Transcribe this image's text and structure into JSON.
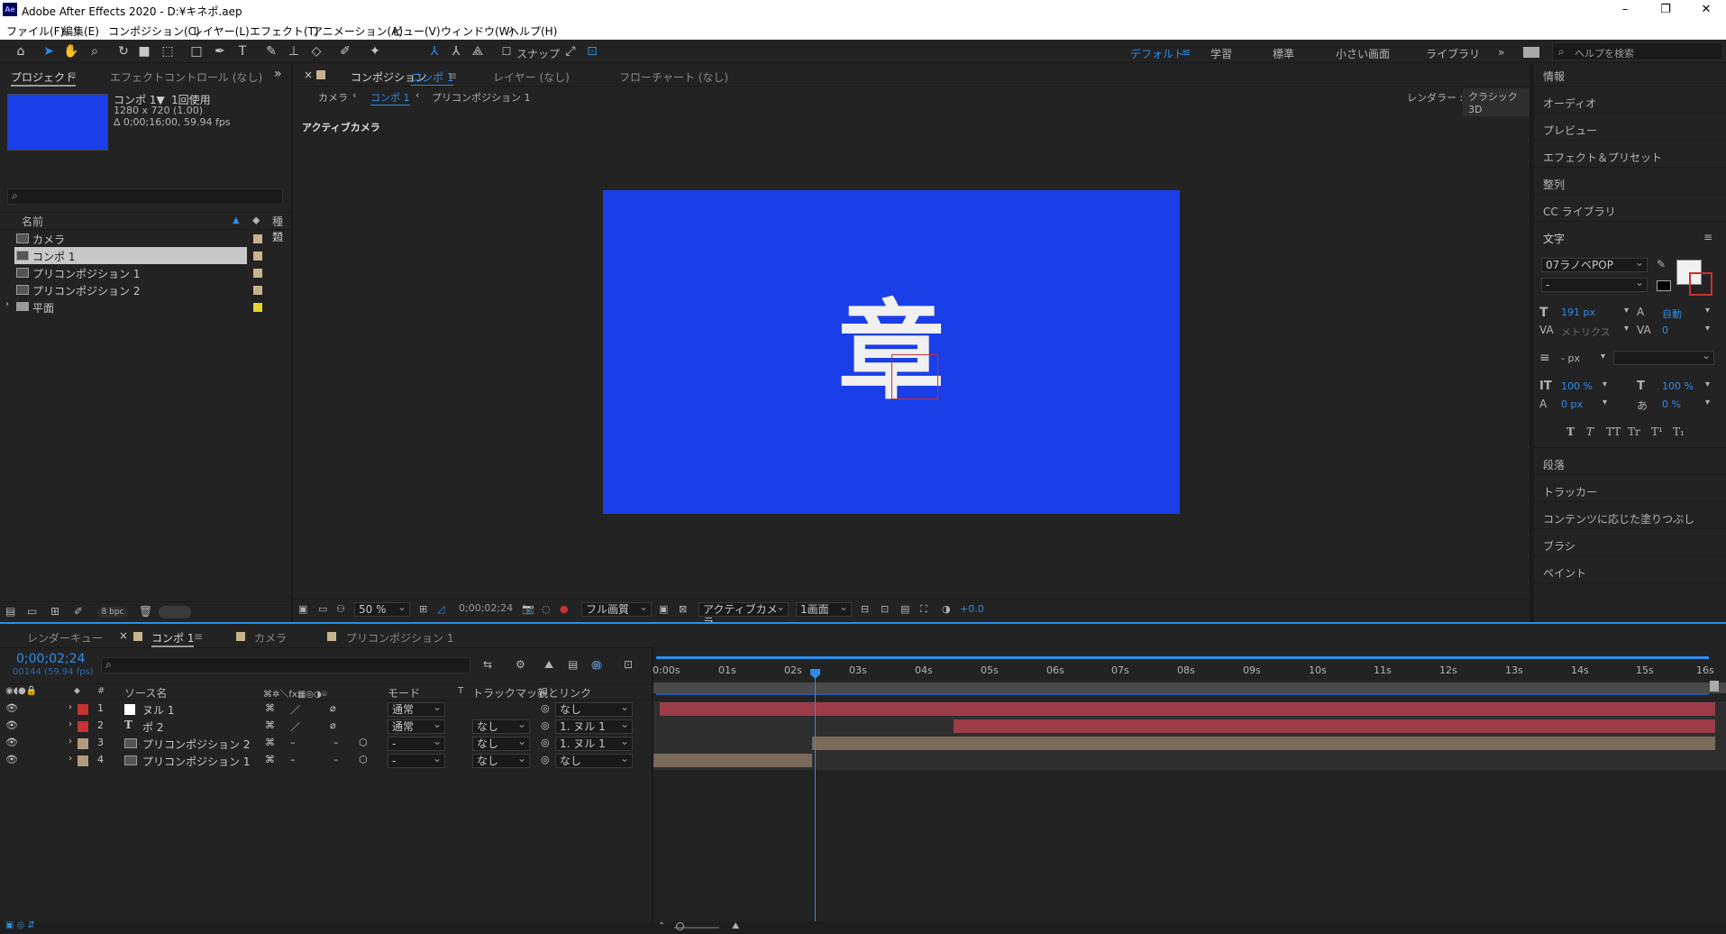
{
  "app": {
    "title": "Adobe After Effects 2020 - D:¥キネポ.aep",
    "logo": "Ae",
    "min": "–",
    "max": "❐",
    "close": "✕"
  },
  "menu": [
    "ファイル(F)",
    "編集(E)",
    "コンポジション(C)",
    "レイヤー(L)",
    "エフェクト(T)",
    "アニメーション(A)",
    "ビュー(V)",
    "ウィンドウ(W)",
    "ヘルプ(H)"
  ],
  "toolbar": {
    "snap_label": "スナップ",
    "workspaces": [
      "デフォルト",
      "学習",
      "標準",
      "小さい画面",
      "ライブラリ"
    ],
    "search_placeholder": "ヘルプを検索"
  },
  "project": {
    "tab": "プロジェクト",
    "tab2": "エフェクトコントロール (なし)",
    "comp_name": "コンポ 1▼",
    "usage": "1回使用",
    "resolution": "1280 x 720 (1.00)",
    "duration": "∆ 0;00;16;00, 59.94 fps",
    "col_name": "名前",
    "col_type": "種類",
    "items": [
      "カメラ",
      "コンポ 1",
      "プリコンポジション 1",
      "プリコンポジション 2",
      "平面"
    ],
    "bpc": "8 bpc"
  },
  "comp": {
    "tab": "コンポジション",
    "tab_name": "コンポ 1",
    "layer_tab": "レイヤー (なし)",
    "flow_tab": "フローチャート (なし)",
    "breadcrumb": [
      "カメラ",
      "コンポ 1",
      "プリコンポジション 1"
    ],
    "renderer_label": "レンダラー :",
    "renderer": "クラシック3D",
    "active_camera_label": "アクティブカメラ",
    "canvas_text": "章",
    "bg_color": "#1a3ee8",
    "zoom": "50 %",
    "timecode": "0;00;02;24",
    "quality": "フル画質",
    "camera": "アクティブカメラ",
    "views": "1画面",
    "exposure": "+0.0"
  },
  "right": {
    "items_top": [
      "情報",
      "オーディオ",
      "プレビュー",
      "エフェクト＆プリセット",
      "整列",
      "CC ライブラリ"
    ],
    "char_title": "文字",
    "font": "07ラノベPOP",
    "style": "-",
    "size": "191 px",
    "leading": "自動",
    "kern": "メトリクス",
    "tracking": "0",
    "line_px": "- px",
    "vscale": "100 %",
    "hscale": "100 %",
    "baseline": "0 px",
    "tsume": "0 %",
    "styles": [
      "T",
      "T",
      "TT",
      "Tr",
      "T¹",
      "T₁"
    ],
    "items_bottom": [
      "段落",
      "トラッカー",
      "コンテンツに応じた塗りつぶし",
      "ブラシ",
      "ペイント"
    ]
  },
  "timeline": {
    "tabs": [
      "レンダーキュー",
      "コンポ 1",
      "カメラ",
      "プリコンポジション 1"
    ],
    "timecode": "0;00;02;24",
    "frames": "00144 (59.94 fps)",
    "col_source": "ソース名",
    "col_mode": "モード",
    "col_t": "T",
    "col_track": "トラックマット",
    "col_parent": "親とリンク",
    "ticks": [
      "0:00s",
      "01s",
      "02s",
      "03s",
      "04s",
      "05s",
      "06s",
      "07s",
      "08s",
      "09s",
      "10s",
      "11s",
      "12s",
      "13s",
      "14s",
      "15s",
      "16s"
    ],
    "layers": [
      {
        "num": "1",
        "name": "ヌル 1",
        "mode": "通常",
        "track": "",
        "parent": "なし",
        "color": "#c83232"
      },
      {
        "num": "2",
        "name": "ポ 2",
        "mode": "通常",
        "track": "なし",
        "parent": "1. ヌル 1",
        "color": "#c83232"
      },
      {
        "num": "3",
        "name": "プリコンポジション 2",
        "mode": "-",
        "track": "なし",
        "parent": "1. ヌル 1",
        "color": "#b49b7d"
      },
      {
        "num": "4",
        "name": "プリコンポジション 1",
        "mode": "-",
        "track": "なし",
        "parent": "なし",
        "color": "#b49b7d"
      }
    ]
  }
}
